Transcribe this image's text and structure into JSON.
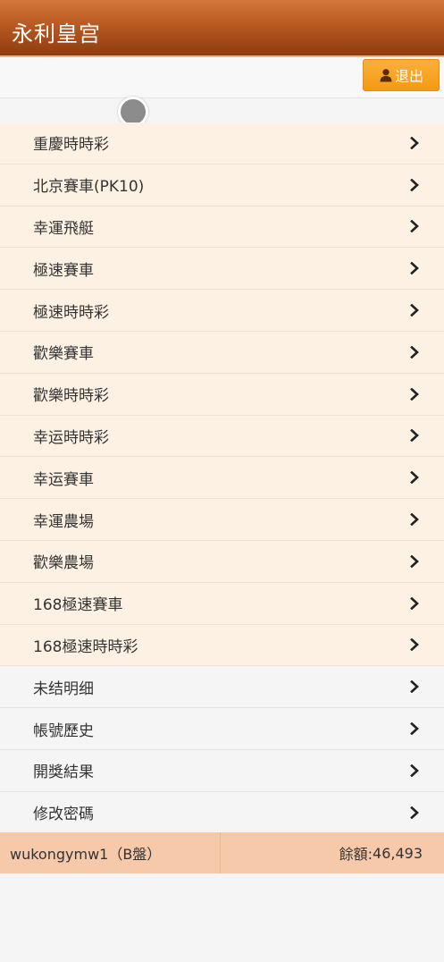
{
  "header": {
    "title": "永利皇宫"
  },
  "toolbar": {
    "logout_label": "退出"
  },
  "menu": {
    "lotteries": [
      {
        "label": "重慶時時彩"
      },
      {
        "label": "北京賽車(PK10)"
      },
      {
        "label": "幸運飛艇"
      },
      {
        "label": "極速賽車"
      },
      {
        "label": "極速時時彩"
      },
      {
        "label": "歡樂賽車"
      },
      {
        "label": "歡樂時時彩"
      },
      {
        "label": "幸运時時彩"
      },
      {
        "label": "幸运賽車"
      },
      {
        "label": "幸運農場"
      },
      {
        "label": "歡樂農場"
      },
      {
        "label": "168極速賽車"
      },
      {
        "label": "168極速時時彩"
      }
    ],
    "account": [
      {
        "label": "未结明细"
      },
      {
        "label": "帳號歷史"
      },
      {
        "label": "開獎結果"
      },
      {
        "label": "修改密碼"
      }
    ]
  },
  "footer": {
    "user": "wukongymw1（B盤）",
    "balance_label": "餘額:",
    "balance_value": "46,493"
  },
  "colors": {
    "header_start": "#d4773a",
    "header_end": "#8f3c10",
    "button": "#f39a12",
    "lottery_bg": "#fdf1e4",
    "footer_bg": "#f7c9ab"
  },
  "icons": {
    "logout": "user-icon",
    "item_arrow": "chevron-right-icon"
  }
}
